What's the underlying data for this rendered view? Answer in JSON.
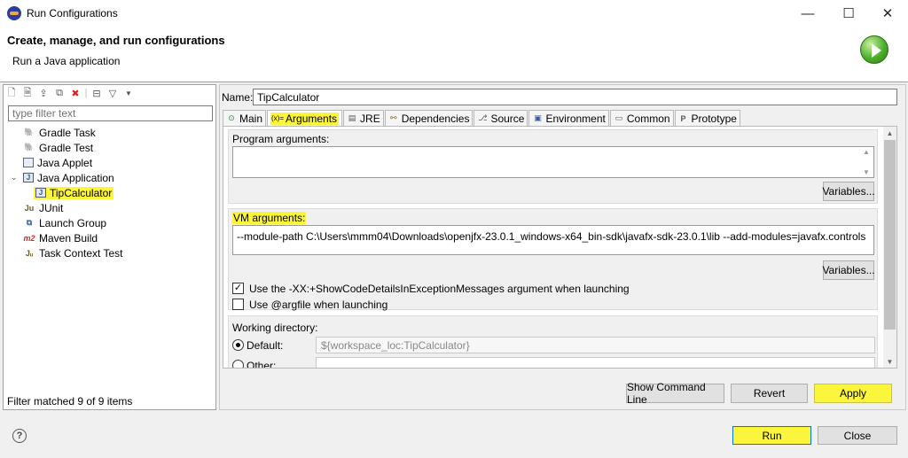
{
  "window": {
    "title": "Run Configurations",
    "minimize": "—",
    "maximize": "☐",
    "close": "✕"
  },
  "header": {
    "title": "Create, manage, and run configurations",
    "subtitle": "Run a Java application"
  },
  "left": {
    "filter_placeholder": "type filter text",
    "tree": [
      {
        "label": "Gradle Task",
        "icon": "gradle-icon",
        "level": 1
      },
      {
        "label": "Gradle Test",
        "icon": "gradle-icon",
        "level": 1
      },
      {
        "label": "Java Applet",
        "icon": "applet-icon",
        "level": 1
      },
      {
        "label": "Java Application",
        "icon": "java-app-icon",
        "level": 1,
        "expanded": true
      },
      {
        "label": "TipCalculator",
        "icon": "java-app-icon",
        "level": 2,
        "selected": true
      },
      {
        "label": "JUnit",
        "icon": "junit-icon",
        "level": 1
      },
      {
        "label": "Launch Group",
        "icon": "launch-group-icon",
        "level": 1
      },
      {
        "label": "Maven Build",
        "icon": "maven-icon",
        "level": 1
      },
      {
        "label": "Task Context Test",
        "icon": "task-context-icon",
        "level": 1
      }
    ],
    "status": "Filter matched 9 of 9 items"
  },
  "config": {
    "name_label": "Name:",
    "name_value": "TipCalculator",
    "tabs": [
      {
        "label": "Main",
        "icon": "main-icon"
      },
      {
        "label": "Arguments",
        "icon": "arguments-icon",
        "active": true
      },
      {
        "label": "JRE",
        "icon": "jre-icon"
      },
      {
        "label": "Dependencies",
        "icon": "dependencies-icon"
      },
      {
        "label": "Source",
        "icon": "source-icon"
      },
      {
        "label": "Environment",
        "icon": "environment-icon"
      },
      {
        "label": "Common",
        "icon": "common-icon"
      },
      {
        "label": "Prototype",
        "icon": "prototype-icon"
      }
    ],
    "program_args_label": "Program arguments:",
    "program_args_value": "",
    "variables_label": "Variables...",
    "vm_args_label": "VM arguments:",
    "vm_args_value": "--module-path C:\\Users\\mmm04\\Downloads\\openjfx-23.0.1_windows-x64_bin-sdk\\javafx-sdk-23.0.1\\lib --add-modules=javafx.controls",
    "show_code_details_label": "Use the -XX:+ShowCodeDetailsInExceptionMessages argument when launching",
    "show_code_details_checked": true,
    "argfile_label": "Use @argfile when launching",
    "argfile_checked": false,
    "working_dir_label": "Working directory:",
    "default_label": "Default:",
    "default_value": "${workspace_loc:TipCalculator}",
    "other_label": "Other:",
    "show_command_line": "Show Command Line",
    "revert": "Revert",
    "apply": "Apply"
  },
  "footer": {
    "run": "Run",
    "close": "Close",
    "help": "?"
  },
  "colors": {
    "highlight": "#fbf53c",
    "run_icon": "#4caf2a"
  }
}
